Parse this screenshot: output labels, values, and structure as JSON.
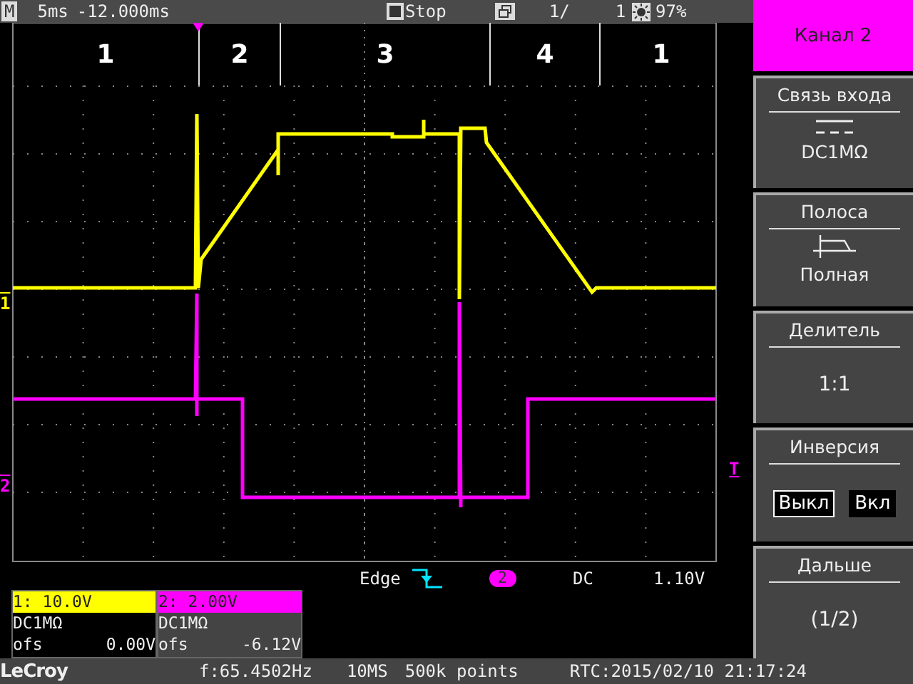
{
  "top_bar": {
    "mode": "M",
    "timebase": "5ms",
    "delay": "-12.000ms",
    "run_state": "Stop",
    "sequence": "1/",
    "sequence_total": "1",
    "battery": "97%"
  },
  "phases": [
    "1",
    "2",
    "3",
    "4",
    "1"
  ],
  "trigger": {
    "type": "Edge",
    "source": "2",
    "coupling": "DC",
    "level": "1.10V",
    "marker": "T"
  },
  "channels": [
    {
      "marker": "1",
      "header": "1: 10.0V",
      "coupling": "DC1MΩ",
      "offset_label": "ofs",
      "offset": "0.00V",
      "color": "#ffff00",
      "selected": false
    },
    {
      "marker": "2",
      "header": "2: 2.00V",
      "coupling": "DC1MΩ",
      "offset_label": "ofs",
      "offset": "-6.12V",
      "color": "#ff00ff",
      "selected": true
    }
  ],
  "menu": {
    "title": "Канал 2",
    "items": [
      {
        "kind": "coupling",
        "title": "Связь входа",
        "value": "DC1MΩ"
      },
      {
        "kind": "bandwidth",
        "title": "Полоса",
        "value": "Полная"
      },
      {
        "kind": "value",
        "title": "Делитель",
        "value": "1:1"
      },
      {
        "kind": "options",
        "title": "Инверсия",
        "options": [
          {
            "label": "Выкл",
            "selected": true
          },
          {
            "label": "Вкл",
            "selected": false
          }
        ]
      },
      {
        "kind": "value",
        "title": "Дальше",
        "value": "(1/2)"
      }
    ]
  },
  "status_bar": {
    "brand": "LeCroy",
    "frequency": "f:65.4502Hz",
    "sample_rate": "10MS",
    "memory": "500k points",
    "clock": "RTC:2015/02/10 21:17:24"
  }
}
